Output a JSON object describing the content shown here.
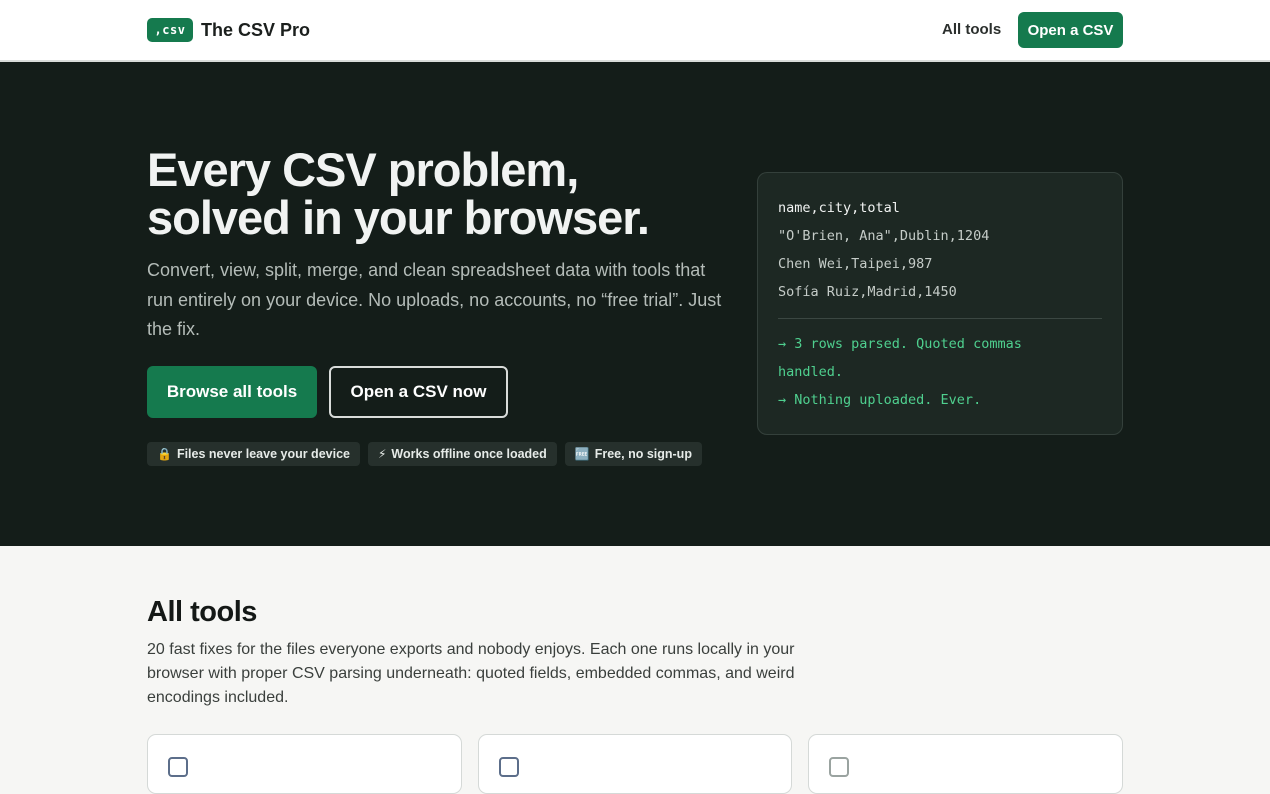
{
  "header": {
    "logo_text": ",csv",
    "brand_name": "The CSV Pro",
    "nav_link": "All tools",
    "cta_label": "Open a CSV",
    "accent_color": "#157a4e"
  },
  "hero": {
    "title_line1": "Every CSV problem,",
    "title_line2": "solved in your browser.",
    "lead": "Convert, view, split, merge, and clean spreadsheet data with tools that run entirely on your device. No uploads, no accounts, no “free trial”. Just the fix.",
    "primary_button": "Browse all tools",
    "secondary_button": "Open a CSV now",
    "pills": [
      {
        "icon": "🔒",
        "icon_name": "lock-icon",
        "label": "Files never leave your device"
      },
      {
        "icon": "⚡",
        "icon_name": "lightning-icon",
        "label": "Works offline once loaded"
      },
      {
        "icon": "🆓",
        "icon_name": "free-icon",
        "label": "Free, no sign-up"
      }
    ],
    "background_color": "#141d19"
  },
  "code_sample": {
    "lines": [
      "name,city,total",
      "\"O'Brien, Ana\",Dublin,1204",
      "Chen Wei,Taipei,987",
      "Sofía Ruiz,Madrid,1450"
    ],
    "output": [
      "→ 3 rows parsed. Quoted commas",
      "handled.",
      "→ Nothing uploaded. Ever."
    ],
    "output_color": "#4fd08f"
  },
  "tools_section": {
    "title": "All tools",
    "description": "20 fast fixes for the files everyone exports and nobody enjoys. Each one runs locally in your browser with proper CSV parsing underneath: quoted fields, embedded commas, and weird encodings included."
  }
}
